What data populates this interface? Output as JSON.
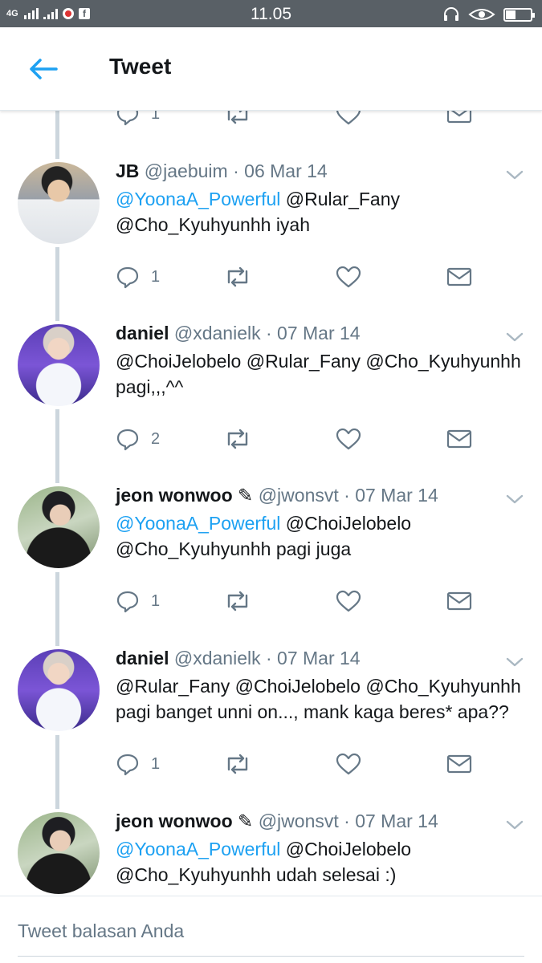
{
  "status_bar": {
    "network": "4G",
    "time": "11.05",
    "fb_glyph": "f"
  },
  "header": {
    "title": "Tweet",
    "back_icon": "arrow-left-icon"
  },
  "colors": {
    "accent": "#1da1f2",
    "muted": "#657786",
    "text": "#14171a",
    "thread_line": "#ccd6dd",
    "status_bar": "#596066"
  },
  "tweets": [
    {
      "name": "JB",
      "handle": "@jaebuim",
      "date": "06 Mar 14",
      "line1": [
        {
          "text": "@YoonaA_Powerful",
          "link": true
        },
        {
          "text": " @Rular_Fany",
          "link": false
        }
      ],
      "line2": [
        {
          "text": "@Cho_Kyuhyunhh iyah",
          "link": false
        }
      ],
      "reply_count": "1"
    },
    {
      "name": "daniel",
      "handle": "@xdanielk",
      "date": "07 Mar 14",
      "line1": [
        {
          "text": "@ChoiJelobelo @Rular_Fany @Cho_Kyuhyunhh",
          "link": false
        }
      ],
      "line2": [
        {
          "text": "pagi,,,^^",
          "link": false
        }
      ],
      "reply_count": "2"
    },
    {
      "name": "jeon wonwoo ✎",
      "handle": "@jwonsvt",
      "date": "07 Mar 14",
      "line1": [
        {
          "text": "@YoonaA_Powerful",
          "link": true
        },
        {
          "text": " @ChoiJelobelo",
          "link": false
        }
      ],
      "line2": [
        {
          "text": "@Cho_Kyuhyunhh pagi juga",
          "link": false
        }
      ],
      "reply_count": "1"
    },
    {
      "name": "daniel",
      "handle": "@xdanielk",
      "date": "07 Mar 14",
      "line1": [
        {
          "text": "@Rular_Fany @ChoiJelobelo @Cho_Kyuhyunhh",
          "link": false
        }
      ],
      "line2": [
        {
          "text": "pagi banget unni on..., mank kaga beres* apa??",
          "link": false
        }
      ],
      "reply_count": "1"
    },
    {
      "name": "jeon wonwoo ✎",
      "handle": "@jwonsvt",
      "date": "07 Mar 14",
      "line1": [
        {
          "text": "@YoonaA_Powerful",
          "link": true
        },
        {
          "text": " @ChoiJelobelo",
          "link": false
        }
      ],
      "line2": [
        {
          "text": "@Cho_Kyuhyunhh udah selesai :)",
          "link": false
        }
      ],
      "reply_count": ""
    }
  ],
  "partial_top_tweet": {
    "reply_count": "1"
  },
  "reply_box": {
    "placeholder": "Tweet balasan Anda"
  }
}
